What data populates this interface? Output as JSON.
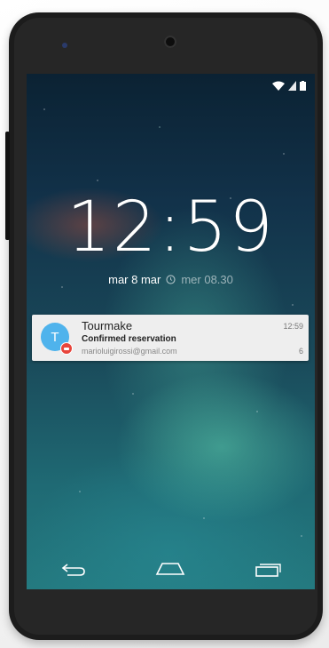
{
  "status_bar": {
    "icons": [
      "wifi-icon",
      "signal-icon",
      "battery-icon"
    ]
  },
  "lockscreen": {
    "time": "12:59",
    "date": "mar 8 mar",
    "alarm_icon": "alarm-icon",
    "alarm": "mer 08.30"
  },
  "notification": {
    "avatar_letter": "T",
    "app": "Tourmake",
    "time": "12:59",
    "title": "Confirmed reservation",
    "account": "marioluigirossi@gmail.com",
    "count": "6",
    "colors": {
      "avatar": "#4fb3ec",
      "badge": "#e8453c"
    }
  },
  "navbar": {
    "buttons": [
      "back-icon",
      "home-icon",
      "recents-icon"
    ]
  }
}
